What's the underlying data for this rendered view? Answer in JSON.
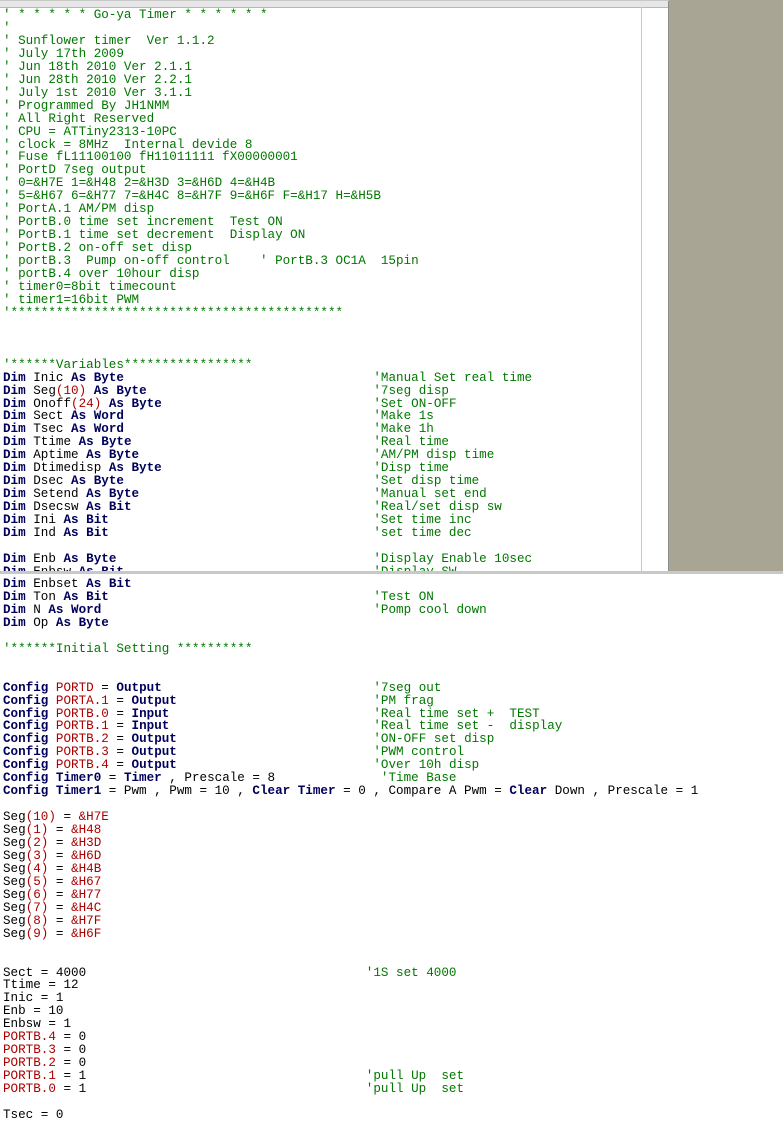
{
  "editor": {
    "top_lines": [
      [
        [
          "g",
          "' * * * * * Go-ya Timer * * * * * *"
        ]
      ],
      [
        [
          "g",
          "'"
        ]
      ],
      [
        [
          "g",
          "' Sunflower timer  Ver 1.1.2"
        ]
      ],
      [
        [
          "g",
          "' July 17th 2009"
        ]
      ],
      [
        [
          "g",
          "' Jun 18th 2010 Ver 2.1.1"
        ]
      ],
      [
        [
          "g",
          "' Jun 28th 2010 Ver 2.2.1"
        ]
      ],
      [
        [
          "g",
          "' July 1st 2010 Ver 3.1.1"
        ]
      ],
      [
        [
          "g",
          "' Programmed By JH1NMM"
        ]
      ],
      [
        [
          "g",
          "' All Right Reserved"
        ]
      ],
      [
        [
          "g",
          "' CPU = ATTiny2313-10PC"
        ]
      ],
      [
        [
          "g",
          "' clock = 8MHz  Internal devide 8"
        ]
      ],
      [
        [
          "g",
          "' Fuse fL11100100 fH11011111 fX00000001"
        ]
      ],
      [
        [
          "g",
          "' PortD 7seg output"
        ]
      ],
      [
        [
          "g",
          "' 0=&H7E 1=&H48 2=&H3D 3=&H6D 4=&H4B"
        ]
      ],
      [
        [
          "g",
          "' 5=&H67 6=&H77 7=&H4C 8=&H7F 9=&H6F F=&H17 H=&H5B"
        ]
      ],
      [
        [
          "g",
          "' PortA.1 AM/PM disp"
        ]
      ],
      [
        [
          "g",
          "' PortB.0 time set increment  Test ON"
        ]
      ],
      [
        [
          "g",
          "' PortB.1 time set decrement  Display ON"
        ]
      ],
      [
        [
          "g",
          "' PortB.2 on-off set disp"
        ]
      ],
      [
        [
          "g",
          "' portB.3  Pump on-off control    ' PortB.3 OC1A  15pin"
        ]
      ],
      [
        [
          "g",
          "' portB.4 over 10hour disp"
        ]
      ],
      [
        [
          "g",
          "' timer0=8bit timecount"
        ]
      ],
      [
        [
          "g",
          "' timer1=16bit PWM"
        ]
      ],
      [
        [
          "g",
          "'********************************************"
        ]
      ],
      [],
      [],
      [],
      [
        [
          "g",
          "'******Variables*****************"
        ]
      ],
      [
        [
          "k",
          "Dim"
        ],
        [
          "b",
          " Inic "
        ],
        [
          "k",
          "As Byte"
        ],
        [
          "p",
          49
        ],
        [
          "g",
          "'Manual Set real time"
        ]
      ],
      [
        [
          "k",
          "Dim"
        ],
        [
          "b",
          " Seg"
        ],
        [
          "r",
          "(10)"
        ],
        [
          "b",
          " "
        ],
        [
          "k",
          "As Byte"
        ],
        [
          "p",
          49
        ],
        [
          "g",
          "'7seg disp"
        ]
      ],
      [
        [
          "k",
          "Dim"
        ],
        [
          "b",
          " Onoff"
        ],
        [
          "r",
          "(24)"
        ],
        [
          "b",
          " "
        ],
        [
          "k",
          "As Byte"
        ],
        [
          "p",
          49
        ],
        [
          "g",
          "'Set ON-OFF"
        ]
      ],
      [
        [
          "k",
          "Dim"
        ],
        [
          "b",
          " Sect "
        ],
        [
          "k",
          "As Word"
        ],
        [
          "p",
          49
        ],
        [
          "g",
          "'Make 1s"
        ]
      ],
      [
        [
          "k",
          "Dim"
        ],
        [
          "b",
          " Tsec "
        ],
        [
          "k",
          "As Word"
        ],
        [
          "p",
          49
        ],
        [
          "g",
          "'Make 1h"
        ]
      ],
      [
        [
          "k",
          "Dim"
        ],
        [
          "b",
          " Ttime "
        ],
        [
          "k",
          "As Byte"
        ],
        [
          "p",
          49
        ],
        [
          "g",
          "'Real time"
        ]
      ],
      [
        [
          "k",
          "Dim"
        ],
        [
          "b",
          " Aptime "
        ],
        [
          "k",
          "As Byte"
        ],
        [
          "p",
          49
        ],
        [
          "g",
          "'AM/PM disp time"
        ]
      ],
      [
        [
          "k",
          "Dim"
        ],
        [
          "b",
          " Dtimedisp "
        ],
        [
          "k",
          "As Byte"
        ],
        [
          "p",
          49
        ],
        [
          "g",
          "'Disp time"
        ]
      ],
      [
        [
          "k",
          "Dim"
        ],
        [
          "b",
          " Dsec "
        ],
        [
          "k",
          "As Byte"
        ],
        [
          "p",
          49
        ],
        [
          "g",
          "'Set disp time"
        ]
      ],
      [
        [
          "k",
          "Dim"
        ],
        [
          "b",
          " Setend "
        ],
        [
          "k",
          "As Byte"
        ],
        [
          "p",
          49
        ],
        [
          "g",
          "'Manual set end"
        ]
      ],
      [
        [
          "k",
          "Dim"
        ],
        [
          "b",
          " Dsecsw "
        ],
        [
          "k",
          "As Bit"
        ],
        [
          "p",
          49
        ],
        [
          "g",
          "'Real/set disp sw"
        ]
      ],
      [
        [
          "k",
          "Dim"
        ],
        [
          "b",
          " Ini "
        ],
        [
          "k",
          "As Bit"
        ],
        [
          "p",
          49
        ],
        [
          "g",
          "'Set time inc"
        ]
      ],
      [
        [
          "k",
          "Dim"
        ],
        [
          "b",
          " Ind "
        ],
        [
          "k",
          "As Bit"
        ],
        [
          "p",
          49
        ],
        [
          "g",
          "'set time dec"
        ]
      ],
      [],
      [
        [
          "k",
          "Dim"
        ],
        [
          "b",
          " Enb "
        ],
        [
          "k",
          "As Byte"
        ],
        [
          "p",
          49
        ],
        [
          "g",
          "'Display Enable 10sec"
        ]
      ],
      [
        [
          "k",
          "Dim"
        ],
        [
          "b",
          " Enbsw "
        ],
        [
          "k",
          "As Bit"
        ],
        [
          "p",
          49
        ],
        [
          "g",
          "'Display SW"
        ]
      ]
    ],
    "bottom_lines": [
      [
        [
          "k",
          "Dim"
        ],
        [
          "b",
          " Enbset "
        ],
        [
          "k",
          "As Bit"
        ]
      ],
      [
        [
          "k",
          "Dim"
        ],
        [
          "b",
          " Ton "
        ],
        [
          "k",
          "As Bit"
        ],
        [
          "p",
          49
        ],
        [
          "g",
          "'Test ON"
        ]
      ],
      [
        [
          "k",
          "Dim"
        ],
        [
          "b",
          " N "
        ],
        [
          "k",
          "As Word"
        ],
        [
          "p",
          49
        ],
        [
          "g",
          "'Pomp cool down"
        ]
      ],
      [
        [
          "k",
          "Dim"
        ],
        [
          "b",
          " Op "
        ],
        [
          "k",
          "As Byte"
        ]
      ],
      [],
      [
        [
          "g",
          "'******Initial Setting **********"
        ]
      ],
      [],
      [],
      [
        [
          "k",
          "Config"
        ],
        [
          "b",
          " "
        ],
        [
          "r",
          "PORTD"
        ],
        [
          "b",
          " = "
        ],
        [
          "k",
          "Output"
        ],
        [
          "p",
          49
        ],
        [
          "g",
          "'7seg out"
        ]
      ],
      [
        [
          "k",
          "Config"
        ],
        [
          "b",
          " "
        ],
        [
          "r",
          "PORTA.1"
        ],
        [
          "b",
          " = "
        ],
        [
          "k",
          "Output"
        ],
        [
          "p",
          49
        ],
        [
          "g",
          "'PM frag"
        ]
      ],
      [
        [
          "k",
          "Config"
        ],
        [
          "b",
          " "
        ],
        [
          "r",
          "PORTB.0"
        ],
        [
          "b",
          " = "
        ],
        [
          "k",
          "Input"
        ],
        [
          "p",
          49
        ],
        [
          "g",
          "'Real time set +  TEST"
        ]
      ],
      [
        [
          "k",
          "Config"
        ],
        [
          "b",
          " "
        ],
        [
          "r",
          "PORTB.1"
        ],
        [
          "b",
          " = "
        ],
        [
          "k",
          "Input"
        ],
        [
          "p",
          49
        ],
        [
          "g",
          "'Real time set -  display"
        ]
      ],
      [
        [
          "k",
          "Config"
        ],
        [
          "b",
          " "
        ],
        [
          "r",
          "PORTB.2"
        ],
        [
          "b",
          " = "
        ],
        [
          "k",
          "Output"
        ],
        [
          "p",
          49
        ],
        [
          "g",
          "'ON-OFF set disp"
        ]
      ],
      [
        [
          "k",
          "Config"
        ],
        [
          "b",
          " "
        ],
        [
          "r",
          "PORTB.3"
        ],
        [
          "b",
          " = "
        ],
        [
          "k",
          "Output"
        ],
        [
          "p",
          49
        ],
        [
          "g",
          "'PWM control"
        ]
      ],
      [
        [
          "k",
          "Config"
        ],
        [
          "b",
          " "
        ],
        [
          "r",
          "PORTB.4"
        ],
        [
          "b",
          " = "
        ],
        [
          "k",
          "Output"
        ],
        [
          "p",
          49
        ],
        [
          "g",
          "'Over 10h disp"
        ]
      ],
      [
        [
          "k",
          "Config Timer0"
        ],
        [
          "b",
          " = "
        ],
        [
          "k",
          "Timer"
        ],
        [
          "b",
          " , Prescale = 8"
        ],
        [
          "p",
          49
        ],
        [
          "g",
          " 'Time Base"
        ]
      ],
      [
        [
          "k",
          "Config Timer1"
        ],
        [
          "b",
          " = Pwm , Pwm = 10 , "
        ],
        [
          "k",
          "Clear Timer"
        ],
        [
          "b",
          " = 0 , Compare A Pwm = "
        ],
        [
          "k",
          "Clear"
        ],
        [
          "b",
          " Down , Prescale = 1"
        ]
      ],
      [],
      [
        [
          "b",
          "Seg"
        ],
        [
          "r",
          "(10)"
        ],
        [
          "b",
          " = "
        ],
        [
          "r",
          "&H7E"
        ]
      ],
      [
        [
          "b",
          "Seg"
        ],
        [
          "r",
          "(1)"
        ],
        [
          "b",
          " = "
        ],
        [
          "r",
          "&H48"
        ]
      ],
      [
        [
          "b",
          "Seg"
        ],
        [
          "r",
          "(2)"
        ],
        [
          "b",
          " = "
        ],
        [
          "r",
          "&H3D"
        ]
      ],
      [
        [
          "b",
          "Seg"
        ],
        [
          "r",
          "(3)"
        ],
        [
          "b",
          " = "
        ],
        [
          "r",
          "&H6D"
        ]
      ],
      [
        [
          "b",
          "Seg"
        ],
        [
          "r",
          "(4)"
        ],
        [
          "b",
          " = "
        ],
        [
          "r",
          "&H4B"
        ]
      ],
      [
        [
          "b",
          "Seg"
        ],
        [
          "r",
          "(5)"
        ],
        [
          "b",
          " = "
        ],
        [
          "r",
          "&H67"
        ]
      ],
      [
        [
          "b",
          "Seg"
        ],
        [
          "r",
          "(6)"
        ],
        [
          "b",
          " = "
        ],
        [
          "r",
          "&H77"
        ]
      ],
      [
        [
          "b",
          "Seg"
        ],
        [
          "r",
          "(7)"
        ],
        [
          "b",
          " = "
        ],
        [
          "r",
          "&H4C"
        ]
      ],
      [
        [
          "b",
          "Seg"
        ],
        [
          "r",
          "(8)"
        ],
        [
          "b",
          " = "
        ],
        [
          "r",
          "&H7F"
        ]
      ],
      [
        [
          "b",
          "Seg"
        ],
        [
          "r",
          "(9)"
        ],
        [
          "b",
          " = "
        ],
        [
          "r",
          "&H6F"
        ]
      ],
      [],
      [],
      [
        [
          "b",
          "Sect = 4000"
        ],
        [
          "p",
          48
        ],
        [
          "g",
          "'1S set 4000"
        ]
      ],
      [
        [
          "b",
          "Ttime = 12"
        ]
      ],
      [
        [
          "b",
          "Inic = 1"
        ]
      ],
      [
        [
          "b",
          "Enb = 10"
        ]
      ],
      [
        [
          "b",
          "Enbsw = 1"
        ]
      ],
      [
        [
          "r",
          "PORTB.4"
        ],
        [
          "b",
          " = 0"
        ]
      ],
      [
        [
          "r",
          "PORTB.3"
        ],
        [
          "b",
          " = 0"
        ]
      ],
      [
        [
          "r",
          "PORTB.2"
        ],
        [
          "b",
          " = 0"
        ]
      ],
      [
        [
          "r",
          "PORTB.1"
        ],
        [
          "b",
          " = 1"
        ],
        [
          "p",
          48
        ],
        [
          "g",
          "'pull Up  set"
        ]
      ],
      [
        [
          "r",
          "PORTB.0"
        ],
        [
          "b",
          " = 1"
        ],
        [
          "p",
          48
        ],
        [
          "g",
          "'pull Up  set"
        ]
      ],
      [],
      [
        [
          "b",
          "Tsec = 0"
        ]
      ]
    ]
  },
  "colors": {
    "comment": "#007700",
    "keyword": "#00005a",
    "literal": "#aa0000",
    "text": "#000000"
  }
}
